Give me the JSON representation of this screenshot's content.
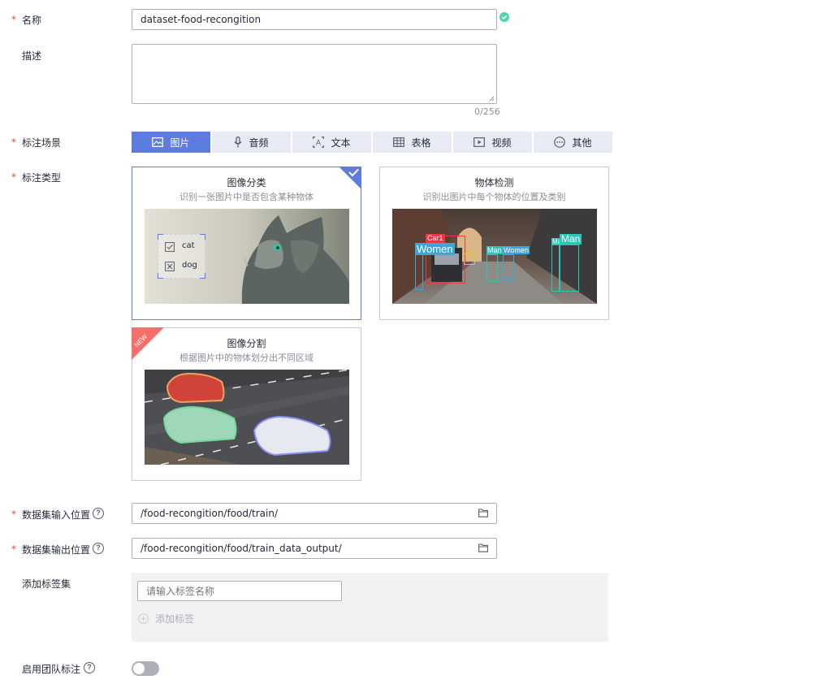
{
  "form": {
    "required_mark": "*",
    "name": {
      "label": "名称",
      "value": "dataset-food-recongition",
      "status_icon": "check-circle-icon"
    },
    "description": {
      "label": "描述",
      "value": "",
      "counter": "0/256"
    },
    "scene": {
      "label": "标注场景",
      "options": [
        {
          "label": "图片",
          "icon": "image-icon",
          "active": true
        },
        {
          "label": "音频",
          "icon": "microphone-icon",
          "active": false
        },
        {
          "label": "文本",
          "icon": "text-icon",
          "active": false
        },
        {
          "label": "表格",
          "icon": "table-icon",
          "active": false
        },
        {
          "label": "视频",
          "icon": "video-icon",
          "active": false
        },
        {
          "label": "其他",
          "icon": "more-icon",
          "active": false
        }
      ]
    },
    "type": {
      "label": "标注类型",
      "cards": [
        {
          "title": "图像分类",
          "desc": "识别一张图片中是否包含某种物体",
          "selected": true,
          "image_labels": [
            "cat",
            "dog"
          ]
        },
        {
          "title": "物体检测",
          "desc": "识别出图片中每个物体的位置及类别",
          "selected": false,
          "image_labels": [
            "Car1",
            "Women",
            "Man",
            "Women",
            "Ma",
            "Man"
          ]
        },
        {
          "title": "图像分割",
          "desc": "根据图片中的物体划分出不同区域",
          "selected": false,
          "badge": "NEW"
        }
      ]
    },
    "input_path": {
      "label": "数据集输入位置",
      "value": "/food-recongition/food/train/"
    },
    "output_path": {
      "label": "数据集输出位置",
      "value": "/food-recongition/food/train_data_output/"
    },
    "label_set": {
      "label": "添加标签集",
      "placeholder": "请输入标签名称",
      "add_label": "添加标签"
    },
    "team": {
      "label": "启用团队标注",
      "enabled": false
    }
  },
  "colors": {
    "accent": "#5e7ce0",
    "success": "#50d4ab",
    "required": "#e84c3d",
    "new_badge": "#f66f6a"
  }
}
